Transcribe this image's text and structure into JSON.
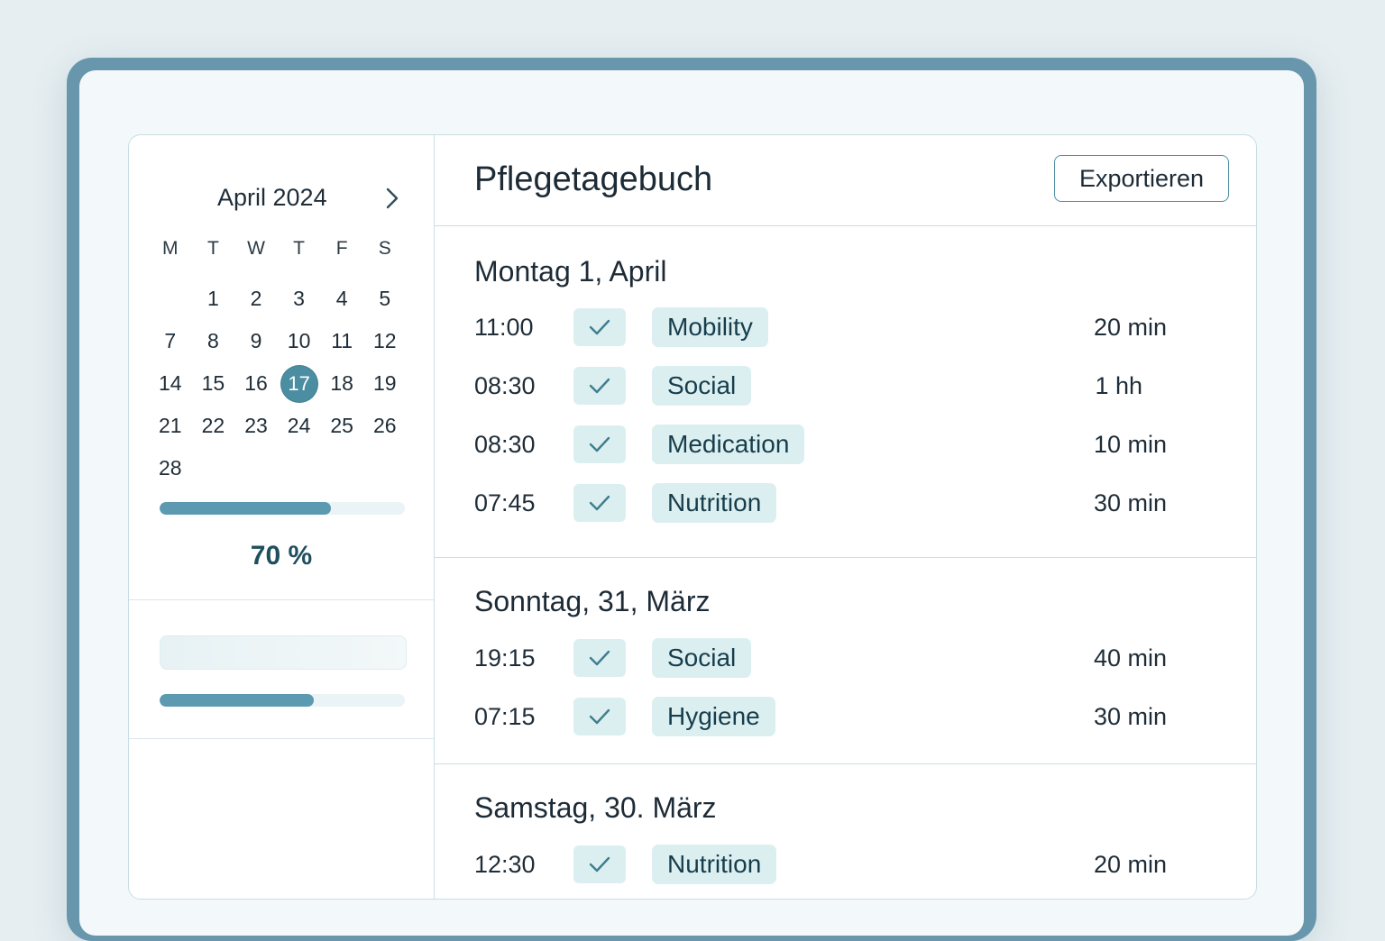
{
  "calendar": {
    "month_label": "April 2024",
    "weekdays": [
      "M",
      "T",
      "W",
      "T",
      "F",
      "S"
    ],
    "weeks": [
      [
        "",
        "1",
        "2",
        "3",
        "4",
        "5"
      ],
      [
        "7",
        "8",
        "9",
        "10",
        "11",
        "12"
      ],
      [
        "14",
        "15",
        "16",
        "17",
        "18",
        "19"
      ],
      [
        "21",
        "22",
        "23",
        "24",
        "25",
        "26"
      ],
      [
        "28",
        "",
        "",
        "",
        "",
        ""
      ]
    ],
    "selected_day": "17",
    "next_icon": "chevron-right-icon"
  },
  "progress": {
    "value": 0.7,
    "label": "70 %",
    "secondary_value": 0.63
  },
  "header": {
    "title": "Pflegetagebuch",
    "export_label": "Exportieren"
  },
  "days": [
    {
      "title": "Montag  1, April",
      "entries": [
        {
          "time": "11:00",
          "category": "Mobility",
          "duration": "20 min"
        },
        {
          "time": "08:30",
          "category": "Social",
          "duration": "1 hh"
        },
        {
          "time": "08:30",
          "category": "Medication",
          "duration": "10 min"
        },
        {
          "time": "07:45",
          "category": "Nutrition",
          "duration": "30 min"
        }
      ]
    },
    {
      "title": "Sonntag, 31, März",
      "entries": [
        {
          "time": "19:15",
          "category": "Social",
          "duration": "40 min"
        },
        {
          "time": "07:15",
          "category": "Hygiene",
          "duration": "30 min"
        }
      ]
    },
    {
      "title": "Samstag, 30. März",
      "entries": [
        {
          "time": "12:30",
          "category": "Nutrition",
          "duration": "20 min"
        }
      ]
    }
  ],
  "colors": {
    "accent": "#4b8ea2",
    "tag_background": "#dceff0",
    "frame": "#6897ad"
  }
}
